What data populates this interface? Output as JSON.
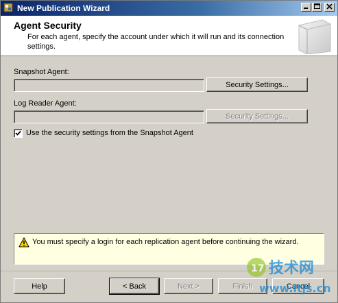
{
  "window": {
    "title": "New Publication Wizard"
  },
  "header": {
    "title": "Agent Security",
    "description": "For each agent, specify the account under which it will run and its connection settings."
  },
  "snapshot": {
    "label": "Snapshot Agent:",
    "value": "",
    "button": "Security Settings..."
  },
  "logreader": {
    "label": "Log Reader Agent:",
    "value": "",
    "button": "Security Settings..."
  },
  "checkbox": {
    "label": "Use the security settings from the Snapshot Agent",
    "checked": true
  },
  "message": "You must specify a login for each replication agent before continuing the wizard.",
  "footer": {
    "help": "Help",
    "back": "< Back",
    "next": "Next >",
    "finish": "Finish",
    "cancel": "Cancel"
  },
  "watermark": {
    "text": "技术网",
    "url": "www.itjs.cn"
  }
}
